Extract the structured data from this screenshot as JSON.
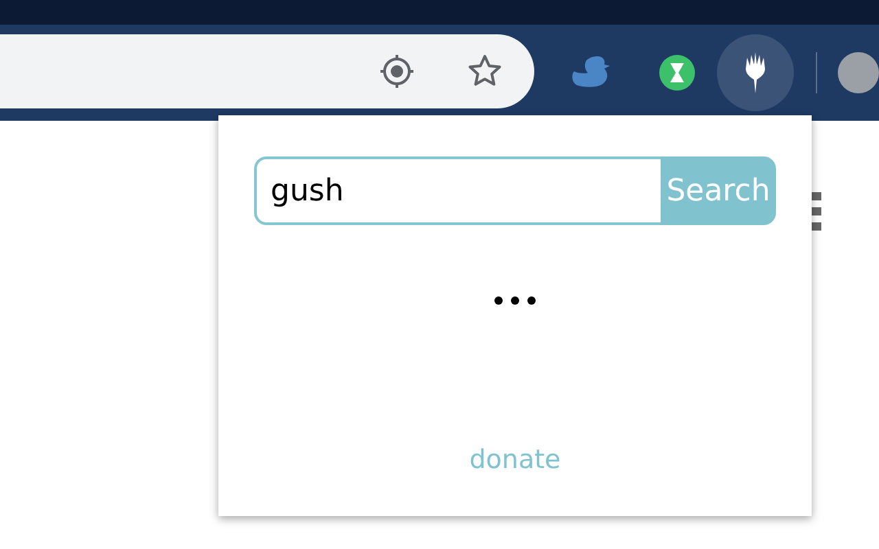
{
  "search": {
    "value": "gush",
    "button": "Search"
  },
  "loading": true,
  "footer": {
    "link": "donate"
  }
}
